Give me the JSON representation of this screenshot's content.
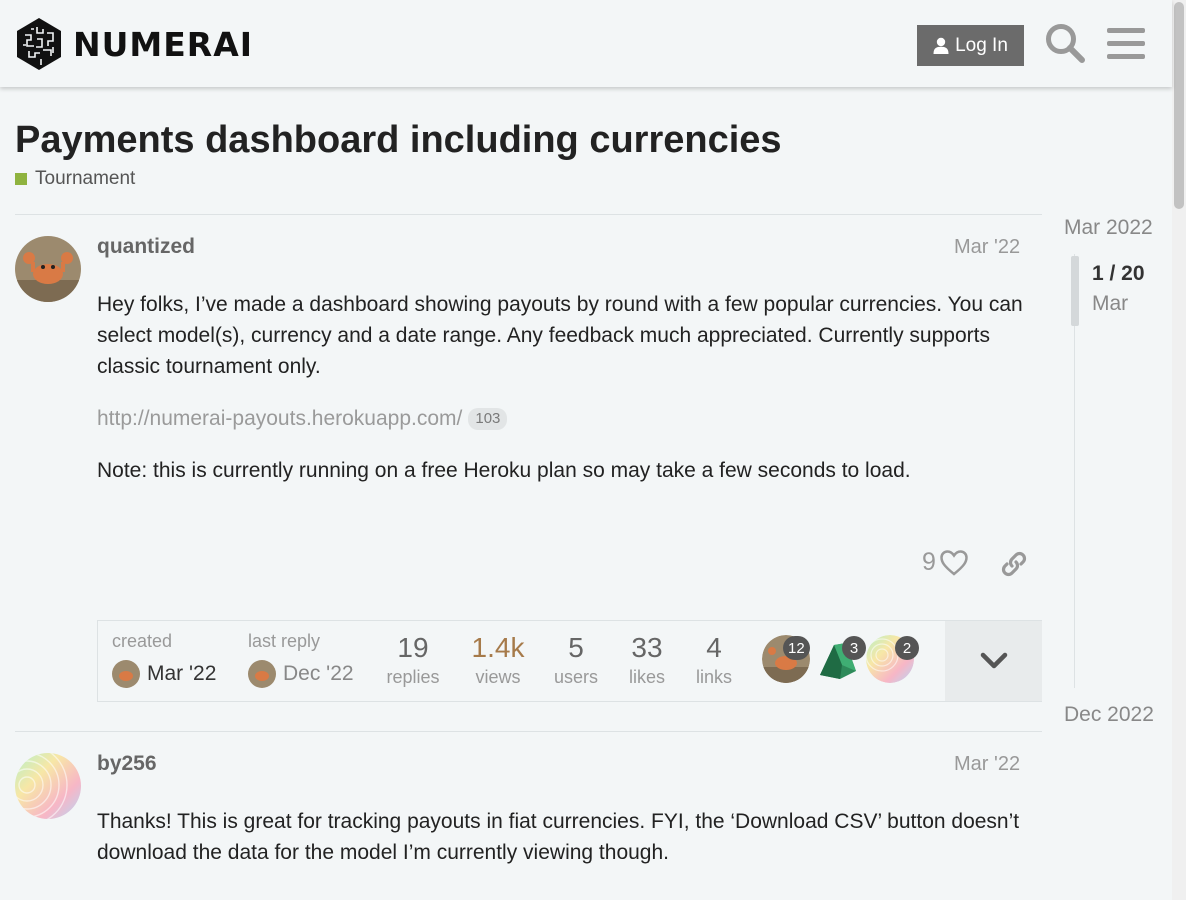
{
  "header": {
    "logo_text": "NUMERAI",
    "login_label": "Log In"
  },
  "topic": {
    "title": "Payments dashboard including currencies",
    "category": "Tournament",
    "category_color": "#8fb33f"
  },
  "posts": [
    {
      "username": "quantized",
      "date": "Mar '22",
      "paragraphs": [
        "Hey folks, I’ve made a dashboard showing payouts by round with a few popular currencies. You can select model(s), currency and a date range. Any feedback much appreciated. Currently supports classic tournament only.",
        "Note: this is currently running on a free Heroku plan so may take a few seconds to load."
      ],
      "link": "http://numerai-payouts.herokuapp.com/",
      "link_clicks": "103",
      "likes": "9"
    },
    {
      "username": "by256",
      "date": "Mar '22",
      "paragraphs": [
        "Thanks! This is great for tracking payouts in fiat currencies. FYI, the ‘Download CSV’ button doesn’t download the data for the model I’m currently viewing though."
      ]
    }
  ],
  "topic_map": {
    "created_label": "created",
    "created_date": "Mar '22",
    "last_reply_label": "last reply",
    "last_reply_date": "Dec '22",
    "stats": [
      {
        "value": "19",
        "label": "replies"
      },
      {
        "value": "1.4k",
        "label": "views"
      },
      {
        "value": "5",
        "label": "users"
      },
      {
        "value": "33",
        "label": "likes"
      },
      {
        "value": "4",
        "label": "links"
      }
    ],
    "participants": [
      {
        "count": "12"
      },
      {
        "count": "3"
      },
      {
        "count": "2"
      }
    ]
  },
  "timeline": {
    "start": "Mar 2022",
    "position": "1 / 20",
    "position_date": "Mar",
    "end": "Dec 2022"
  },
  "icons": {
    "search": "search-icon",
    "menu": "hamburger-menu-icon",
    "like": "heart-icon",
    "share": "link-icon",
    "expand": "chevron-down-icon",
    "user": "user-icon"
  }
}
